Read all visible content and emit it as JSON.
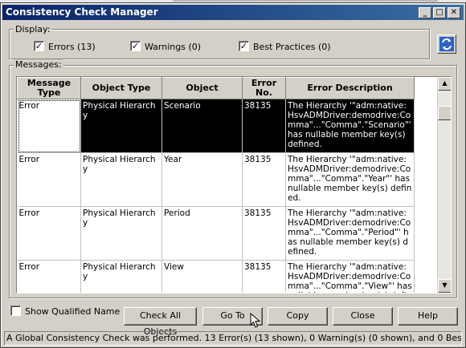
{
  "window": {
    "title": "Consistency Check Manager"
  },
  "display": {
    "label": "Display:",
    "errors": {
      "label": "Errors (13)",
      "checked": true
    },
    "warnings": {
      "label": "Warnings (0)",
      "checked": true
    },
    "best_practices": {
      "label": "Best Practices (0)",
      "checked": true
    }
  },
  "messages": {
    "label": "Messages:",
    "columns": [
      "Message Type",
      "Object Type",
      "Object",
      "Error No.",
      "Error Description"
    ],
    "rows": [
      {
        "type": "Error",
        "object_type": "Physical Hierarchy",
        "object": "Scenario",
        "error_no": "38135",
        "description": "The Hierarchy '\"adm:native:HsvADMDriver:demodrive:Comma\"...\"Comma\".\"Scenario\"' has nullable member key(s) defined."
      },
      {
        "type": "Error",
        "object_type": "Physical Hierarchy",
        "object": "Year",
        "error_no": "38135",
        "description": "The Hierarchy '\"adm:native:HsvADMDriver:demodrive:Comma\"...\"Comma\".\"Year\"' has nullable member key(s) defined."
      },
      {
        "type": "Error",
        "object_type": "Physical Hierarchy",
        "object": "Period",
        "error_no": "38135",
        "description": "The Hierarchy '\"adm:native:HsvADMDriver:demodrive:Comma\"...\"Comma\".\"Period\"' has nullable member key(s) defined."
      },
      {
        "type": "Error",
        "object_type": "Physical Hierarchy",
        "object": "View",
        "error_no": "38135",
        "description": "The Hierarchy '\"adm:native:HsvADMDriver:demodrive:Comma\"...\"Comma\".\"View\"' has nullable member key(s) defined."
      }
    ]
  },
  "show_qualified_name": {
    "label": "Show Qualified Name",
    "checked": false
  },
  "buttons": {
    "check_all": "Check All Objects",
    "go_to": "Go To",
    "copy": "Copy",
    "close": "Close",
    "help": "Help"
  },
  "status": "A Global Consistency Check was performed. 13 Error(s) (13 shown), 0 Warning(s) (0 shown), and 0 Best Practice viola",
  "icons": [
    "minimize-icon",
    "maximize-icon",
    "close-icon",
    "refresh-icon",
    "scroll-up-icon",
    "scroll-down-icon",
    "mouse-pointer-icon"
  ]
}
